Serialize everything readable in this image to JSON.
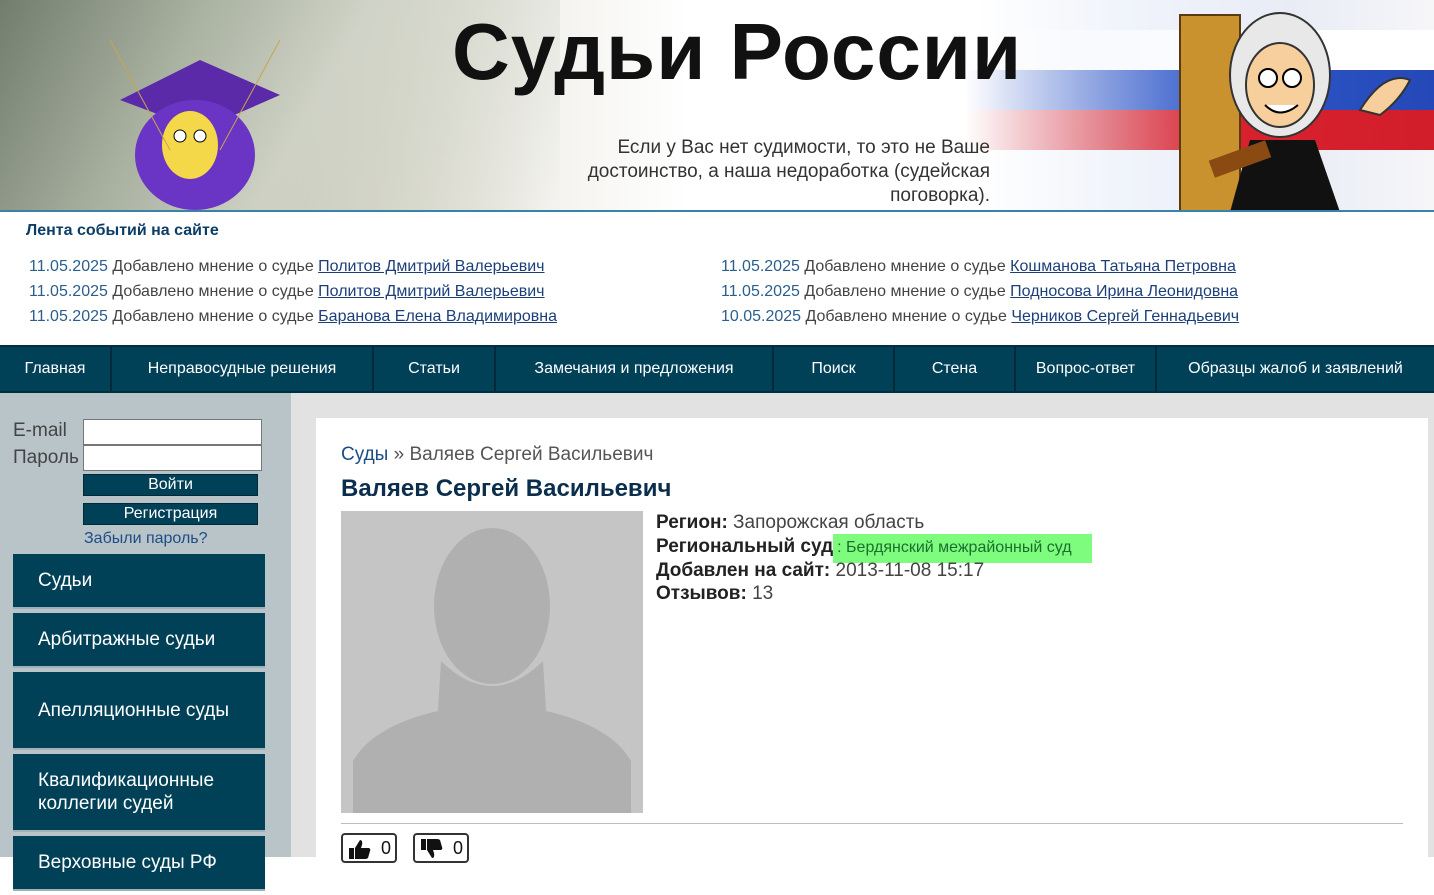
{
  "header": {
    "site_title": "Судьи России",
    "tagline_line1": "Если у Вас нет судимости, то это не Ваше",
    "tagline_line2": "достоинство, а наша недоработка (судейская",
    "tagline_line3": "поговорка)."
  },
  "events": {
    "title": "Лента событий на сайте",
    "left": [
      {
        "date": "11.05.2025",
        "text": " Добавлено мнение о судье ",
        "link": "Политов Дмитрий Валерьевич"
      },
      {
        "date": "11.05.2025",
        "text": " Добавлено мнение о судье ",
        "link": "Политов Дмитрий Валерьевич"
      },
      {
        "date": "11.05.2025",
        "text": " Добавлено мнение о судье ",
        "link": "Баранова Елена Владимировна"
      }
    ],
    "right": [
      {
        "date": "11.05.2025",
        "text": " Добавлено мнение о судье ",
        "link": "Кошманова Татьяна Петровна"
      },
      {
        "date": "11.05.2025",
        "text": " Добавлено мнение о судье ",
        "link": "Подносова Ирина Леонидовна"
      },
      {
        "date": "10.05.2025",
        "text": " Добавлено мнение о судье ",
        "link": "Черников Сергей Геннадьевич"
      }
    ]
  },
  "nav": {
    "items": [
      "Главная",
      "Неправосудные решения",
      "Статьи",
      "Замечания и предложения",
      "Поиск",
      "Стена",
      "Вопрос-ответ",
      "Образцы жалоб и заявлений"
    ]
  },
  "login": {
    "email_label": "E-mail",
    "password_label": "Пароль",
    "login_button": "Войти",
    "register_button": "Регистрация",
    "forgot_link": "Забыли пароль?"
  },
  "sidebar": {
    "items": [
      "Судьи",
      "Арбитражные судьи",
      "Апелляционные суды",
      "Квалификационные коллегии судей",
      "Верховные суды РФ"
    ]
  },
  "profile": {
    "breadcrumb_root": "Суды",
    "breadcrumb_sep": " » ",
    "breadcrumb_current": "Валяев Сергей Васильевич",
    "name": "Валяев Сергей Васильевич",
    "region_label": "Регион:",
    "region_value": " Запорожская область",
    "court_label": "Региональный суд",
    "court_value": ": Бердянский межрайонный суд",
    "added_label": "Добавлен на сайт:",
    "added_value": " 2013-11-08 15:17",
    "reviews_label": "Отзывов:",
    "reviews_value": " 13",
    "likes": "0",
    "dislikes": "0"
  },
  "colors": {
    "nav_bg": "#004158",
    "highlight": "#7dfc7d",
    "link": "#1c3f7a"
  }
}
